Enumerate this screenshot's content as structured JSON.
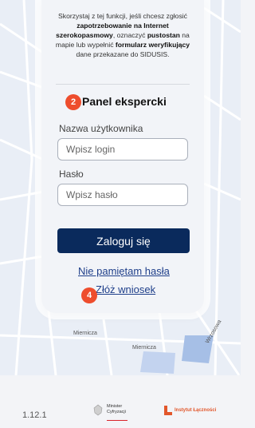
{
  "intro": {
    "line1": "Skorzystaj z tej funkcji, jeśli chcesz zgłosić",
    "bold1": "zapotrzebowanie na Internet szerokopasmowy",
    "line2": ", oznaczyć",
    "bold2": "pustostan",
    "line3": " na mapie lub wypełnić",
    "bold3": "formularz weryfikujący",
    "line4": " dane przekazane do SIDUSIS."
  },
  "panel": {
    "badge": "2",
    "title": "Panel ekspercki"
  },
  "form": {
    "username_label": "Nazwa użytkownika",
    "username_placeholder": "Wpisz login",
    "password_label": "Hasło",
    "password_placeholder": "Wpisz hasło",
    "login_button": "Zaloguj się"
  },
  "links": {
    "forgot": "Nie pamiętam hasła",
    "apply": "Złóż wniosek",
    "apply_badge": "4"
  },
  "map": {
    "street1": "Miernicza",
    "street2": "Miernicza",
    "street3": "Wrzosowa"
  },
  "footer": {
    "version": "1.12.1",
    "logo1_line1": "Minister",
    "logo1_line2": "Cyfryzacji",
    "logo2": "Instytut Łączności"
  },
  "colors": {
    "accent": "#0a2a5c",
    "badge": "#ee4d2d",
    "link": "#1f3f8a"
  }
}
